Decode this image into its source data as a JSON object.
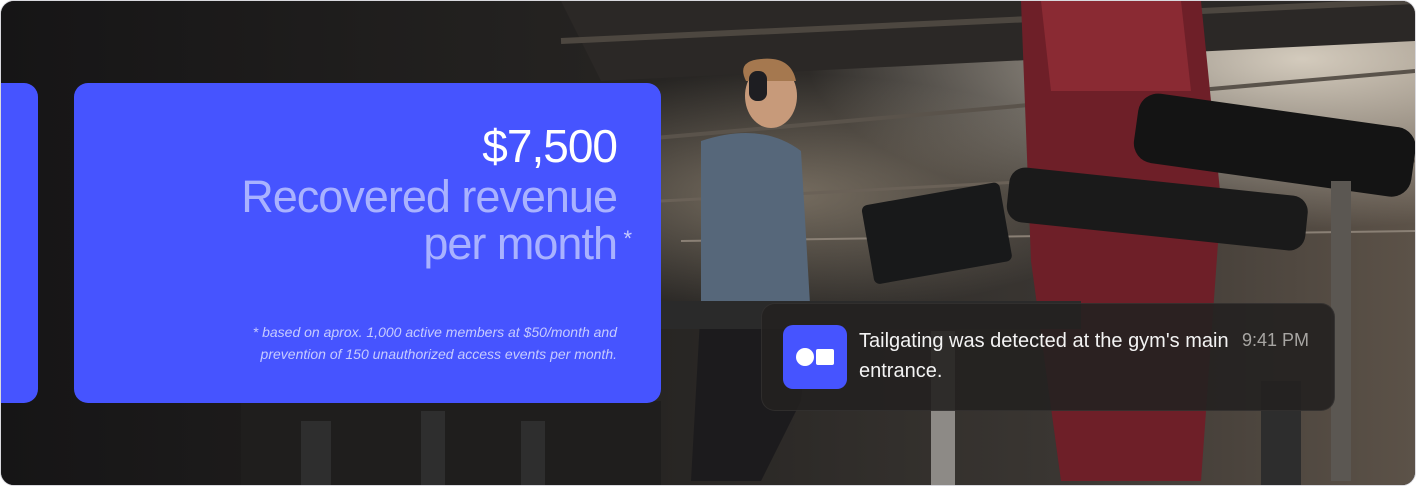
{
  "stat": {
    "amount": "$7,500",
    "headline": "Recovered revenue per month",
    "asterisk": "*",
    "footnote": "* based on  aprox. 1,000 active members at $50/month and prevention of 150 unauthorized access events per month."
  },
  "notification": {
    "app_icon": "camera-logo-icon",
    "message": "Tailgating was detected at the gym's main entrance.",
    "time": "9:41 PM"
  },
  "colors": {
    "brand_blue": "#4654ff",
    "headline_tint": "#a9b2ff",
    "toast_bg": "#242120"
  }
}
